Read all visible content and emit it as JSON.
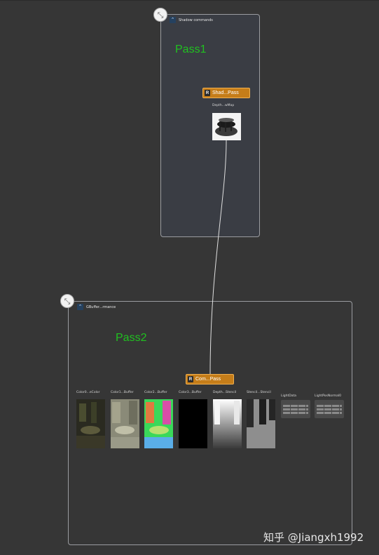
{
  "groups": {
    "shadow": {
      "title": "Shadow commands",
      "pass_label": "Pass1",
      "collapse_icon": "collapse-arrows-icon"
    },
    "gbuffer": {
      "title": "GBuffer...rmance",
      "pass_label": "Pass2",
      "collapse_icon": "collapse-arrows-icon"
    }
  },
  "nodes": {
    "shadow_pass": {
      "badge": "R",
      "label": "Shad...Pass",
      "color": "#c57d19"
    },
    "combine_pass": {
      "badge": "R",
      "label": "Com...Pass",
      "color": "#c57d19"
    }
  },
  "shadow_output": {
    "label": "Depth...wMap"
  },
  "gbuffer_textures": [
    {
      "label": "Color0...eColor"
    },
    {
      "label": "Color1...Buffer"
    },
    {
      "label": "Color2...Buffer"
    },
    {
      "label": "Color3...Buffer"
    },
    {
      "label": "Depth...Stencil"
    },
    {
      "label": "Stencil...Stencil"
    }
  ],
  "buffers": [
    {
      "label": "LightData"
    },
    {
      "label": "LightPosNormal0"
    }
  ],
  "watermark": "知乎 @Jiangxh1992",
  "colors": {
    "accent": "#c57d19",
    "pass_label": "#20c020",
    "link": "#e0e0e0"
  }
}
